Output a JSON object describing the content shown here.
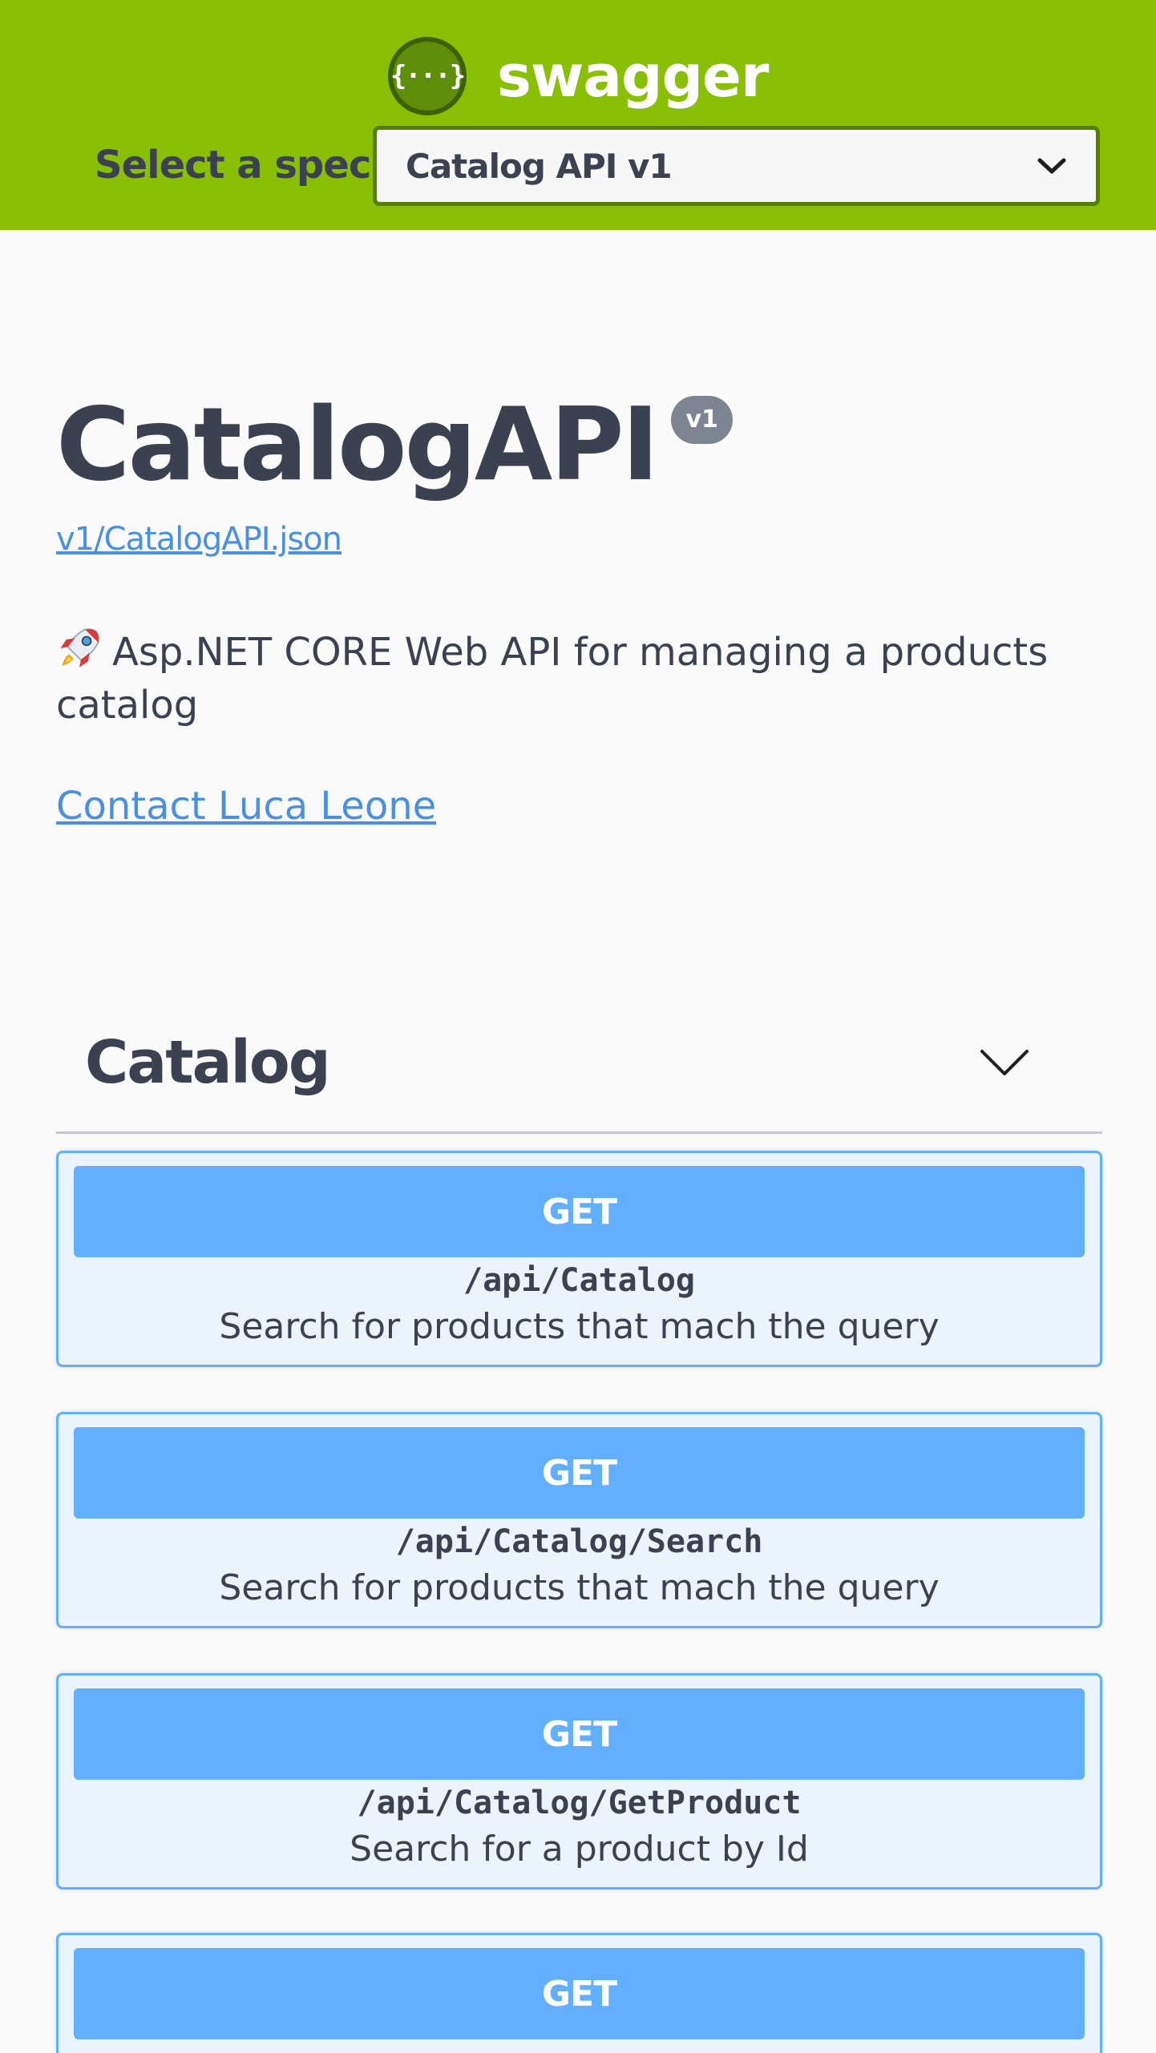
{
  "topbar": {
    "brand_icon": "swagger-logo-icon",
    "brand_icon_glyph": "{···}",
    "brand_name": "swagger",
    "spec_label": "Select a spec",
    "spec_selected": "Catalog API v1",
    "colors": {
      "background": "#89bf04",
      "select_border": "#547f00"
    }
  },
  "info": {
    "title": "CatalogAPI",
    "version": "v1",
    "spec_url": "v1/CatalogAPI.json",
    "description_icon": "rocket-icon",
    "description": "Asp.NET CORE Web API for managing a products catalog",
    "contact": "Contact Luca Leone"
  },
  "tags": [
    {
      "name": "Catalog",
      "expanded": true,
      "operations": [
        {
          "method": "GET",
          "path": "/api/Catalog",
          "summary": "Search for products that mach the query"
        },
        {
          "method": "GET",
          "path": "/api/Catalog/Search",
          "summary": "Search for products that mach the query"
        },
        {
          "method": "GET",
          "path": "/api/Catalog/GetProduct",
          "summary": "Search for a product by Id"
        },
        {
          "method": "GET"
        }
      ]
    }
  ],
  "colors": {
    "get_method": "#61affe",
    "get_background": "#ebf3fb",
    "link": "#4990e2",
    "text": "#3b4151"
  }
}
